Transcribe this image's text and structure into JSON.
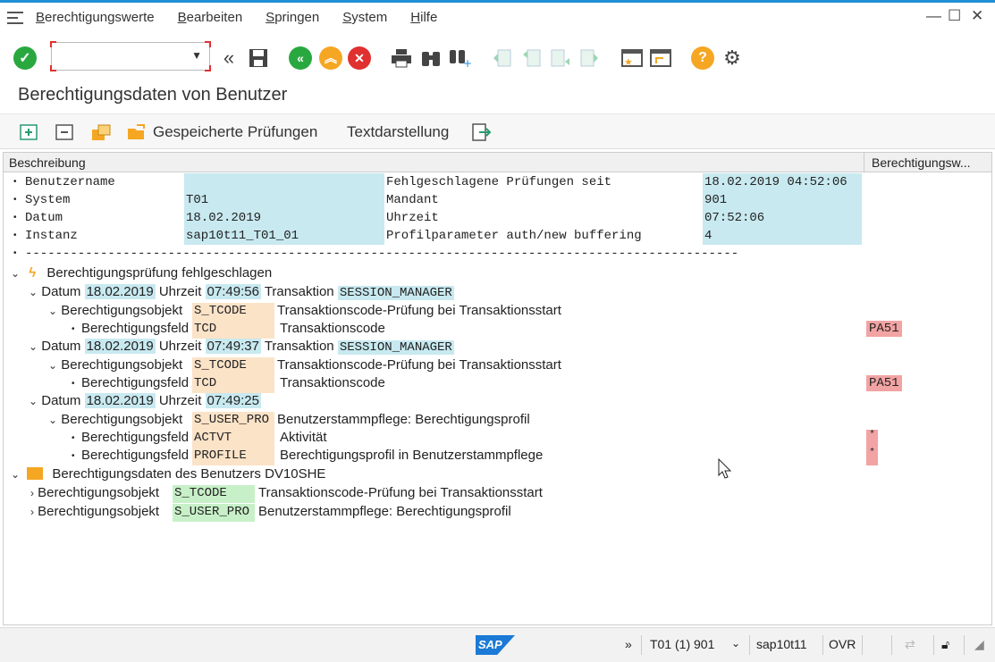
{
  "menu": [
    "Berechtigungswerte",
    "Bearbeiten",
    "Springen",
    "System",
    "Hilfe"
  ],
  "window_controls": {
    "minimize": "—",
    "maximize": "☐",
    "close": "✕"
  },
  "toolbar": {
    "command_value": "",
    "icons": [
      "check-icon",
      "back-arrows-icon",
      "save-icon",
      "back-icon",
      "exit-icon",
      "cancel-icon",
      "print-icon",
      "find-icon",
      "find-next-icon",
      "first-page-icon",
      "previous-page-icon",
      "next-page-icon",
      "last-page-icon",
      "new-session-icon",
      "shortcut-icon",
      "help-icon",
      "settings-icon"
    ]
  },
  "title": "Berechtigungsdaten von Benutzer",
  "app_toolbar": {
    "saved_checks": "Gespeicherte Prüfungen",
    "text_view": "Textdarstellung"
  },
  "columns": {
    "description": "Beschreibung",
    "auth_values": "Berechtigungsw..."
  },
  "header": {
    "rows": [
      {
        "label": "Benutzername",
        "value": "",
        "label2": "Fehlgeschlagene Prüfungen seit",
        "value2": "18.02.2019 04:52:06"
      },
      {
        "label": "System",
        "value": "T01",
        "label2": "Mandant",
        "value2": "901"
      },
      {
        "label": "Datum",
        "value": "18.02.2019",
        "label2": "Uhrzeit",
        "value2": "07:52:06"
      },
      {
        "label": "Instanz",
        "value": "sap10t11_T01_01",
        "label2": "Profilparameter auth/new buffering",
        "value2": "4"
      }
    ],
    "separator": "-----------------------------------------------------------------------------------------------"
  },
  "failed": {
    "title": "Berechtigungsprüfung fehlgeschlagen",
    "lbl_date": "Datum",
    "lbl_time": "Uhrzeit",
    "lbl_tx": "Transaktion",
    "lbl_obj": "Berechtigungsobjekt",
    "lbl_field": "Berechtigungsfeld",
    "entries": [
      {
        "date": "18.02.2019",
        "time": "07:49:56",
        "tx": "SESSION_MANAGER",
        "obj": "S_TCODE",
        "obj_desc": "Transaktionscode-Prüfung bei Transaktionsstart",
        "field": "TCD",
        "field_desc": "Transaktionscode",
        "value": "PA51"
      },
      {
        "date": "18.02.2019",
        "time": "07:49:37",
        "tx": "SESSION_MANAGER",
        "obj": "S_TCODE",
        "obj_desc": "Transaktionscode-Prüfung bei Transaktionsstart",
        "field": "TCD",
        "field_desc": "Transaktionscode",
        "value": "PA51"
      },
      {
        "date": "18.02.2019",
        "time": "07:49:25",
        "obj": "S_USER_PRO",
        "obj_desc": "Benutzerstammpflege: Berechtigungsprofil",
        "field1": "ACTVT",
        "field1_desc": "Aktivität",
        "value1": "*",
        "field2": "PROFILE",
        "field2_desc": "Berechtigungsprofil in Benutzerstammpflege",
        "value2": "*"
      }
    ]
  },
  "userdata": {
    "title": "Berechtigungsdaten des Benutzers DV10SHE",
    "lbl_obj": "Berechtigungsobjekt",
    "items": [
      {
        "obj": "S_TCODE",
        "desc": "Transaktionscode-Prüfung bei Transaktionsstart"
      },
      {
        "obj": "S_USER_PRO",
        "desc": "Benutzerstammpflege: Berechtigungsprofil"
      }
    ]
  },
  "status": {
    "more": "»",
    "system": "T01 (1) 901",
    "server": "sap10t11",
    "mode": "OVR",
    "logo": "SAP"
  },
  "colors": {
    "accent": "#1f8fd6",
    "cyan_field": "#c8e9f0",
    "orange_field": "#fbe3c8",
    "green_field": "#c8f0c8",
    "red_value": "#f2a3a3"
  }
}
